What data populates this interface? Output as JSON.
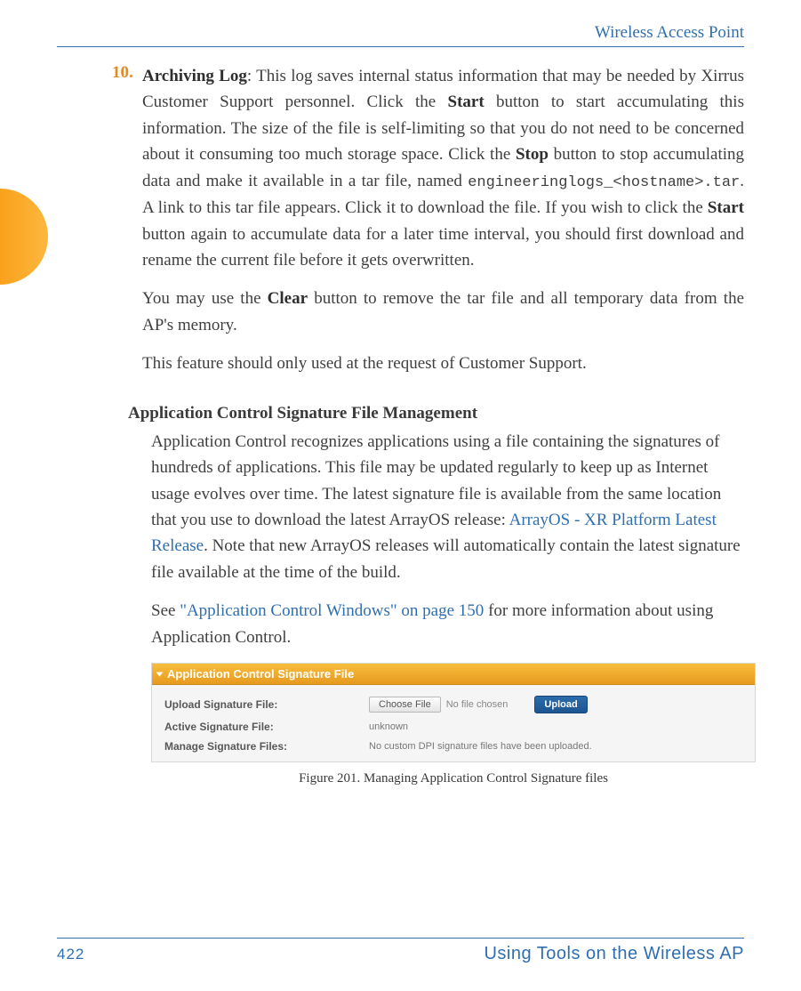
{
  "header": {
    "title": "Wireless Access Point"
  },
  "item10": {
    "number": "10.",
    "title": "Archiving Log",
    "p1a": ": This log saves internal status information that may be needed by Xirrus Customer Support personnel. Click the ",
    "start": "Start",
    "p1b": " button to start accumulating this information. The size of the file is self-limiting so that you do not need to be concerned about it consuming too much storage space. Click the ",
    "stop": "Stop",
    "p1c": " button to stop accumulating data and make it available in a tar file, named ",
    "filename": "engineeringlogs_<hostname>.tar",
    "p1d": ". A link to this tar file appears. Click it to download the file. If you wish to click the ",
    "start2": "Start",
    "p1e": " button again to accumulate data for a later time interval, you should first download and rename the current file before it gets overwritten.",
    "p2a": "You may use the ",
    "clear": "Clear",
    "p2b": " button to remove the tar file and all temporary data from the AP's memory.",
    "p3": "This feature should only used at the request of Customer Support."
  },
  "section": {
    "heading": "Application Control Signature File Management",
    "p1a": "Application Control recognizes applications using a file containing the signatures of hundreds of applications. This file may be updated regularly to keep up as Internet usage evolves over time. The latest signature file is available from the same location that you use to download the latest ArrayOS release: ",
    "link1": "ArrayOS - XR Platform Latest Release",
    "p1b": ". Note that new ArrayOS releases will automatically contain the latest signature file available at the time of the build.",
    "p2a": "See ",
    "link2": "\"Application Control Windows\" on page 150",
    "p2b": " for more information about using Application Control."
  },
  "panel": {
    "title": "Application Control Signature File",
    "rows": {
      "upload_label": "Upload Signature File:",
      "choose_btn": "Choose File",
      "no_file": "No file chosen",
      "upload_btn": "Upload",
      "active_label": "Active Signature File:",
      "active_value": "unknown",
      "manage_label": "Manage Signature Files:",
      "manage_value": "No custom DPI signature files have been uploaded."
    }
  },
  "figure_caption": "Figure 201. Managing Application Control Signature files",
  "footer": {
    "page": "422",
    "title": "Using Tools on the Wireless AP"
  }
}
